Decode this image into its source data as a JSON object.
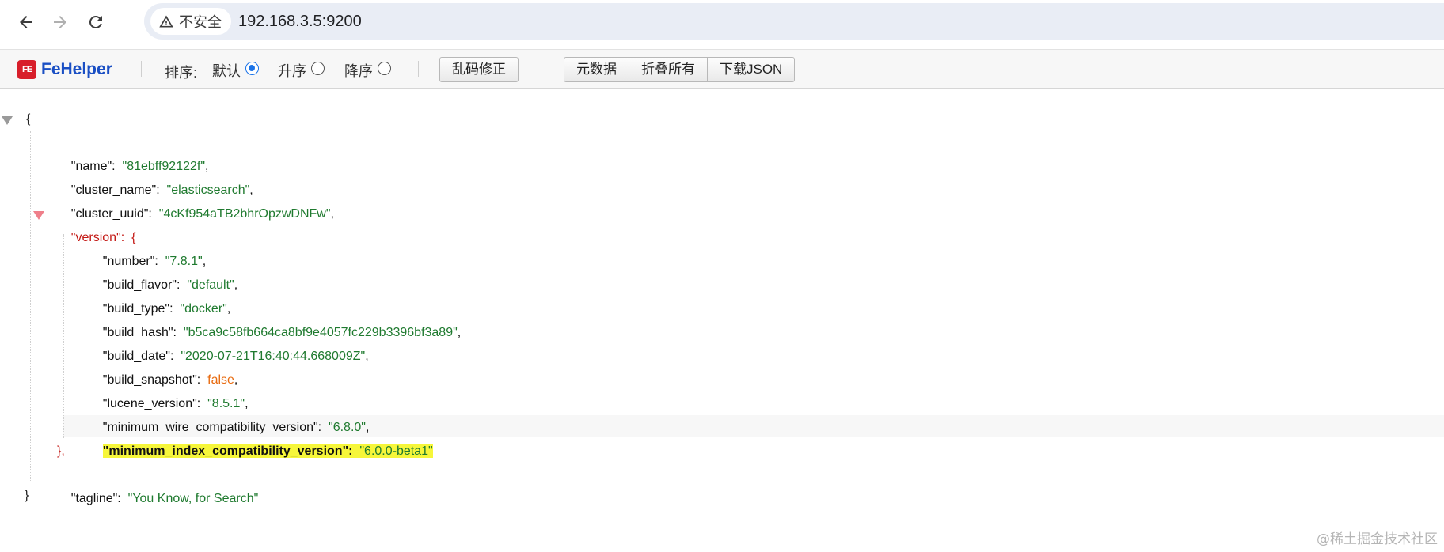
{
  "browser": {
    "security_label": "不安全",
    "url": "192.168.3.5:9200"
  },
  "fehelper": {
    "logo_mark": "FE",
    "logo_text": "FeHelper",
    "sort_label": "排序:",
    "sort_options": [
      {
        "label": "默认",
        "selected": true
      },
      {
        "label": "升序",
        "selected": false
      },
      {
        "label": "降序",
        "selected": false
      }
    ],
    "buttons": {
      "fix_encoding": "乱码修正",
      "raw_data": "元数据",
      "collapse_all": "折叠所有",
      "download_json": "下载JSON"
    }
  },
  "json_view": {
    "open_brace": "{",
    "close_brace": "}",
    "top": [
      {
        "key": "\"name\"",
        "value": "\"81ebff92122f\""
      },
      {
        "key": "\"cluster_name\"",
        "value": "\"elasticsearch\""
      },
      {
        "key": "\"cluster_uuid\"",
        "value": "\"4cKf954aTB2bhrOpzwDNFw\""
      }
    ],
    "version_key": "\"version\"",
    "version_open": "{",
    "version_close": "},",
    "version": [
      {
        "key": "\"number\"",
        "value": "\"7.8.1\"",
        "type": "string"
      },
      {
        "key": "\"build_flavor\"",
        "value": "\"default\"",
        "type": "string"
      },
      {
        "key": "\"build_type\"",
        "value": "\"docker\"",
        "type": "string"
      },
      {
        "key": "\"build_hash\"",
        "value": "\"b5ca9c58fb664ca8bf9e4057fc229b3396bf3a89\"",
        "type": "string"
      },
      {
        "key": "\"build_date\"",
        "value": "\"2020-07-21T16:40:44.668009Z\"",
        "type": "string"
      },
      {
        "key": "\"build_snapshot\"",
        "value": "false",
        "type": "boolean"
      },
      {
        "key": "\"lucene_version\"",
        "value": "\"8.5.1\"",
        "type": "string"
      },
      {
        "key": "\"minimum_wire_compatibility_version\"",
        "value": "\"6.8.0\"",
        "type": "string"
      },
      {
        "key": "\"minimum_index_compatibility_version\"",
        "value": "\"6.0.0-beta1\"",
        "type": "string"
      }
    ],
    "tagline_key": "\"tagline\"",
    "tagline_value": "\"You Know, for Search\""
  },
  "watermark": "@稀土掘金技术社区",
  "colors": {
    "string": "#1f7a2f",
    "boolean": "#e86b10",
    "active_key": "#c41a16",
    "highlight": "#f6f63a"
  }
}
